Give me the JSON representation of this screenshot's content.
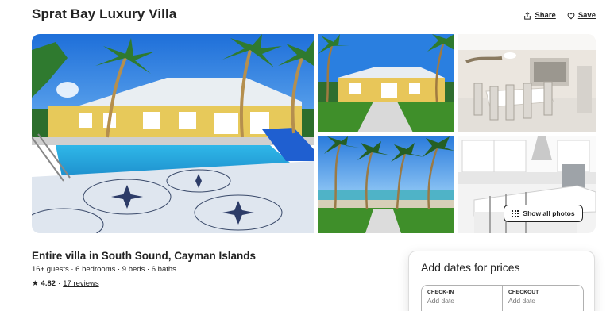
{
  "listing": {
    "title": "Sprat Bay Luxury Villa",
    "share_label": "Share",
    "save_label": "Save",
    "show_all_label": "Show all photos",
    "subtitle": "Entire villa in South Sound, Cayman Islands",
    "details": "16+ guests · 6 bedrooms · 9 beds · 6 baths",
    "rating": "4.82",
    "reviews": "17 reviews"
  },
  "booking": {
    "title": "Add dates for prices",
    "checkin_label": "CHECK-IN",
    "checkin_value": "Add date",
    "checkout_label": "CHECKOUT",
    "checkout_value": "Add date"
  },
  "icons": {
    "share": "share-icon",
    "save": "heart-icon",
    "show_all": "grid-icon",
    "star": "star-icon"
  },
  "colors": {
    "text": "#222222",
    "muted": "#717171",
    "border": "#dddddd"
  }
}
